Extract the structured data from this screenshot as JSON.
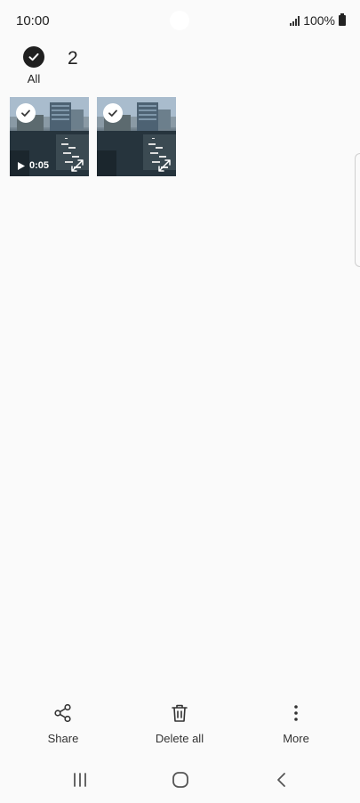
{
  "status_bar": {
    "time": "10:00",
    "battery": "100%",
    "icons": [
      "signal-icon",
      "battery-icon"
    ]
  },
  "header": {
    "select_all_label": "All",
    "selected_count": "2"
  },
  "items": [
    {
      "type": "video",
      "duration": "0:05",
      "selected": true
    },
    {
      "type": "image",
      "selected": true
    }
  ],
  "actions": [
    {
      "label": "Share",
      "icon": "share-icon"
    },
    {
      "label": "Delete all",
      "icon": "trash-icon"
    },
    {
      "label": "More",
      "icon": "more-vertical-icon"
    }
  ],
  "nav": [
    "recent-apps-icon",
    "home-icon",
    "back-icon"
  ]
}
